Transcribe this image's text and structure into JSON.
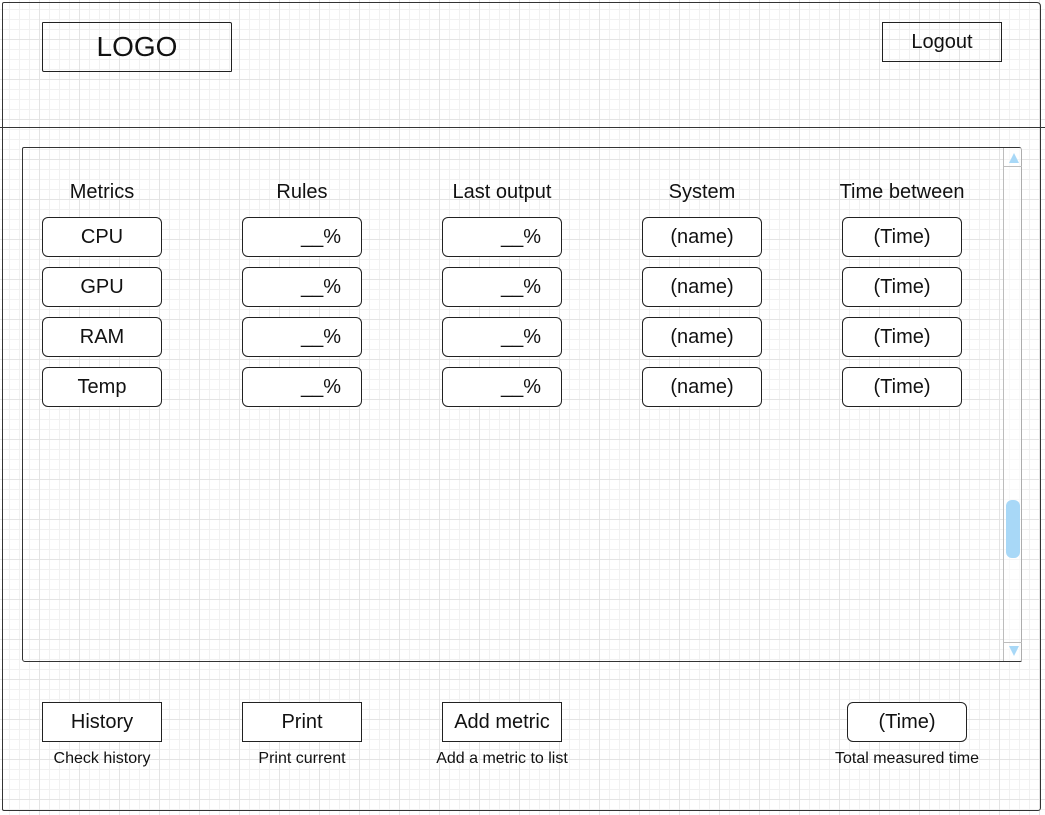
{
  "header": {
    "logo_text": "LOGO",
    "logout_label": "Logout"
  },
  "table": {
    "columns": [
      "Metrics",
      "Rules",
      "Last output",
      "System",
      "Time between"
    ],
    "rows": [
      {
        "metric": "CPU",
        "rule": "__%",
        "last_output": "__%",
        "system": "(name)",
        "time_between": "(Time)"
      },
      {
        "metric": "GPU",
        "rule": "__%",
        "last_output": "__%",
        "system": "(name)",
        "time_between": "(Time)"
      },
      {
        "metric": "RAM",
        "rule": "__%",
        "last_output": "__%",
        "system": "(name)",
        "time_between": "(Time)"
      },
      {
        "metric": "Temp",
        "rule": "__%",
        "last_output": "__%",
        "system": "(name)",
        "time_between": "(Time)"
      }
    ]
  },
  "footer": {
    "history_label": "History",
    "history_caption": "Check history",
    "print_label": "Print",
    "print_caption": "Print current",
    "add_metric_label": "Add metric",
    "add_metric_caption": "Add a metric to list",
    "total_time_value": "(Time)",
    "total_time_caption": "Total measured time"
  },
  "colors": {
    "scrollbar_accent": "#a8d8f7",
    "stroke": "#222222"
  }
}
